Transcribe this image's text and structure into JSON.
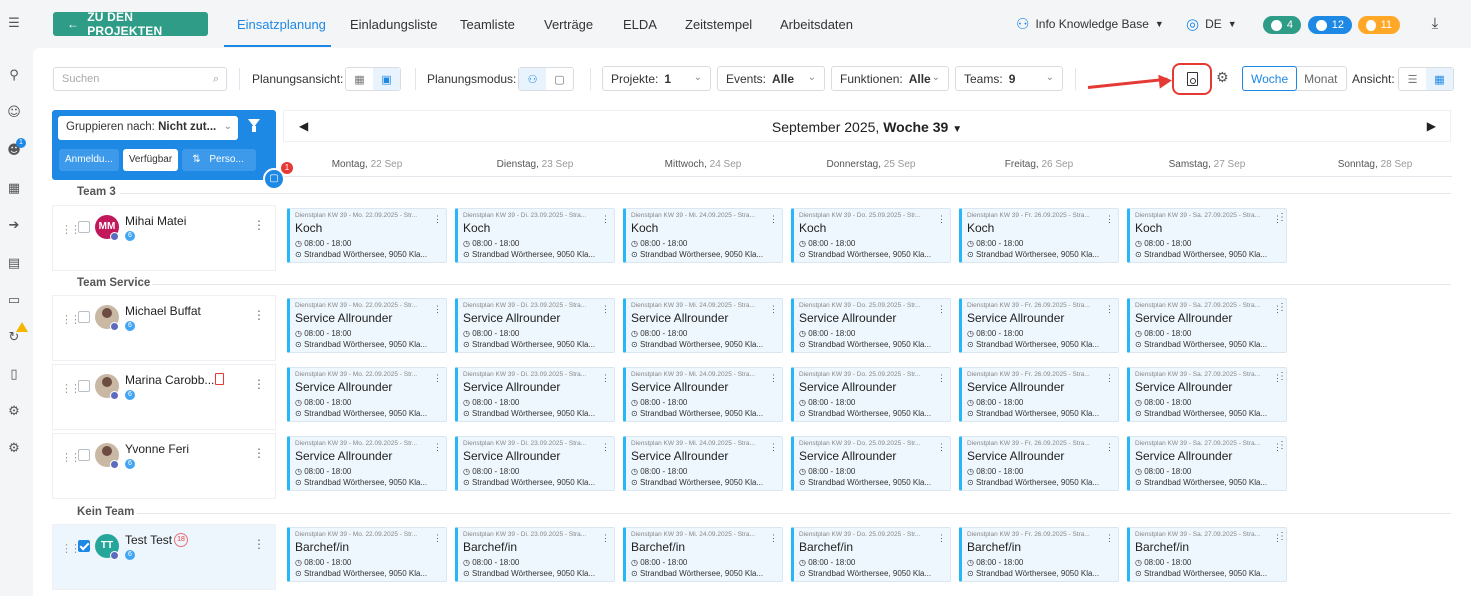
{
  "topnav": {
    "back_button": "ZU DEN PROJEKTEN",
    "tabs": [
      "Einsatzplanung",
      "Einladungsliste",
      "Teamliste",
      "Verträge",
      "ELDA",
      "Zeitstempel",
      "Arbeitsdaten"
    ],
    "active_tab": "Einsatzplanung",
    "user": "Info Knowledge Base",
    "language": "DE",
    "badges": [
      {
        "name": "messages",
        "count": "4",
        "color": "#2e9c86"
      },
      {
        "name": "notifications",
        "count": "12",
        "color": "#1e88e5"
      },
      {
        "name": "timers",
        "count": "11",
        "color": "#ffa726"
      }
    ]
  },
  "sidebar": {
    "icons": [
      "org-chart-icon",
      "users-icon",
      "add-user-icon",
      "calendar-icon",
      "login-icon",
      "building-icon",
      "cash-icon",
      "sync-icon",
      "document-icon",
      "settings-icon",
      "user-settings-icon"
    ],
    "add_user_badge": "1"
  },
  "toolbar": {
    "search_placeholder": "Suchen",
    "planning_view_label": "Planungsansicht:",
    "planning_mode_label": "Planungsmodus:",
    "filters": [
      {
        "label": "Projekte:",
        "value": "1"
      },
      {
        "label": "Events:",
        "value": "Alle"
      },
      {
        "label": "Funktionen:",
        "value": "Alle"
      },
      {
        "label": "Teams:",
        "value": "9"
      }
    ],
    "week_label": "Woche",
    "month_label": "Monat",
    "view_label": "Ansicht:",
    "accent_color": "#1e88e5",
    "highlight_color": "#e53935"
  },
  "groupPanel": {
    "group_label": "Gruppieren nach:",
    "group_value": "Nicht zut...",
    "buttons": [
      "Anmeldu...",
      "Verfügbar",
      "Perso..."
    ],
    "active_button": "Verfügbar",
    "fab_badge": "1"
  },
  "calendar": {
    "month": "September 2025,",
    "week": "Woche 39",
    "days": [
      {
        "name": "Montag,",
        "date": "22 Sep"
      },
      {
        "name": "Dienstag,",
        "date": "23 Sep"
      },
      {
        "name": "Mittwoch,",
        "date": "24 Sep"
      },
      {
        "name": "Donnerstag,",
        "date": "25 Sep"
      },
      {
        "name": "Freitag,",
        "date": "26 Sep"
      },
      {
        "name": "Samstag,",
        "date": "27 Sep"
      },
      {
        "name": "Sonntag,",
        "date": "28 Sep"
      }
    ]
  },
  "teams": [
    {
      "name": "Team 3",
      "people": [
        {
          "name": "Mihai Matei",
          "initials": "MM",
          "avatar_color": "#c2185b",
          "count": "6",
          "role": "Koch",
          "checked": false
        }
      ]
    },
    {
      "name": "Team Service",
      "people": [
        {
          "name": "Michael Buffat",
          "initials": "",
          "avatar_color": "",
          "count": "6",
          "role": "Service Allrounder",
          "checked": false
        },
        {
          "name": "Marina Carobb...",
          "initials": "",
          "avatar_color": "",
          "count": "6",
          "role": "Service Allrounder",
          "checked": false,
          "pdf": true
        },
        {
          "name": "Yvonne Feri",
          "initials": "",
          "avatar_color": "",
          "count": "6",
          "role": "Service Allrounder",
          "checked": false
        }
      ]
    },
    {
      "name": "Kein Team",
      "people": [
        {
          "name": "Test Test",
          "initials": "TT",
          "avatar_color": "#26a69a",
          "count": "6",
          "role": "Barchef/in",
          "checked": true,
          "ring": "18"
        }
      ]
    }
  ],
  "shift": {
    "headers": [
      "Dienstplan KW 39 - Mo. 22.09.2025 - Str...",
      "Dienstplan KW 39 - Di. 23.09.2025 - Stra...",
      "Dienstplan KW 39 - Mi. 24.09.2025 - Stra...",
      "Dienstplan KW 39 - Do. 25.09.2025 - Str...",
      "Dienstplan KW 39 - Fr. 26.09.2025 - Stra...",
      "Dienstplan KW 39 - Sa. 27.09.2025 - Stra..."
    ],
    "time": "08:00 - 18:00",
    "location": "Strandbad Wörthersee, 9050 Kla..."
  }
}
